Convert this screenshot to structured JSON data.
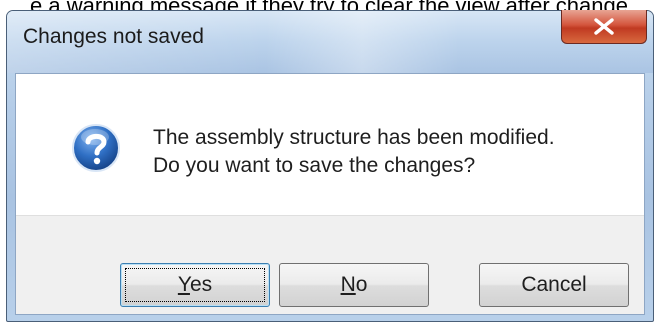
{
  "background_text": "e a warning message if they try to clear the view after change",
  "dialog": {
    "title": "Changes not saved",
    "close_glyph": "X",
    "icon": "question-icon",
    "message_line1": "The assembly structure has been modified.",
    "message_line2": "Do you want to save the changes?",
    "buttons": {
      "yes": {
        "mnemonic": "Y",
        "rest": "es"
      },
      "no": {
        "mnemonic": "N",
        "rest": "o"
      },
      "cancel": "Cancel"
    },
    "default_button": "Yes"
  },
  "colors": {
    "title_bar": "#bcd3ec",
    "close_button": "#c7432b",
    "icon_blue": "#1f5ba8",
    "button_face": "#e5e5e5"
  }
}
